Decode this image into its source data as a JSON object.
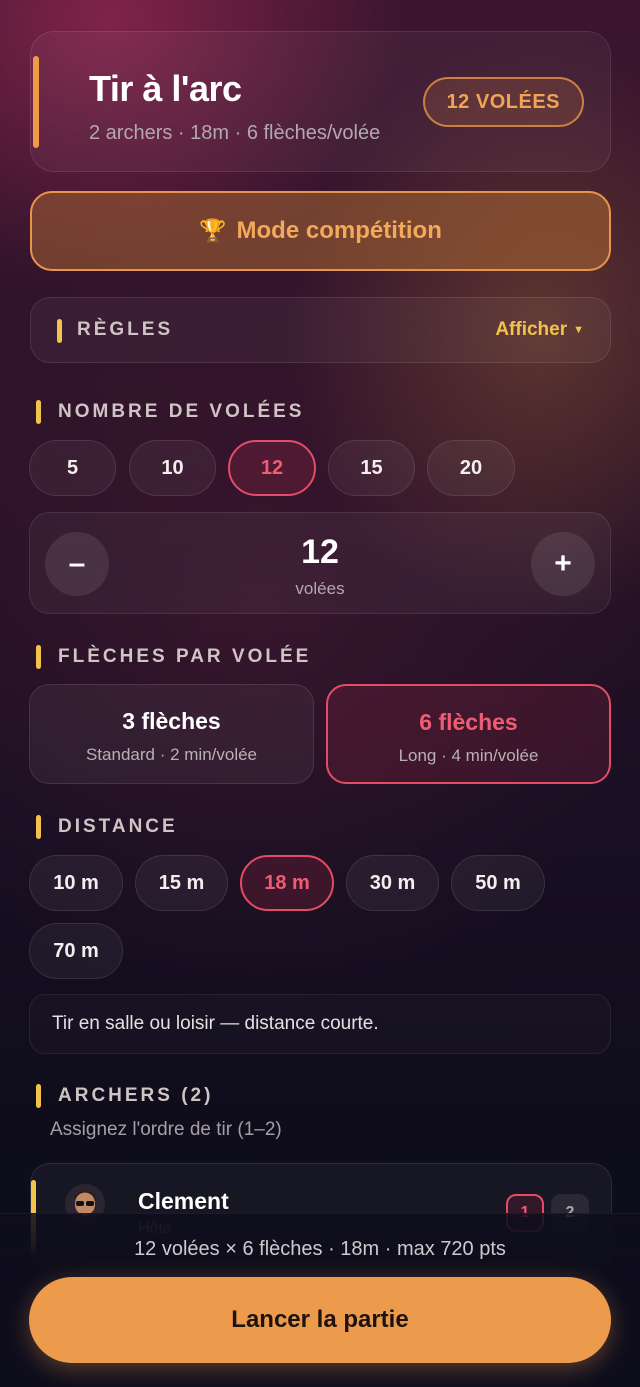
{
  "header": {
    "title": "Tir à l'arc",
    "subtitle": "2 archers · 18m · 6 flèches/volée",
    "badge": "12 VOLÉES"
  },
  "mode": {
    "icon": "trophy-icon",
    "label": "Mode compétition"
  },
  "rules": {
    "label": "RÈGLES",
    "toggle": "Afficher",
    "toggle_icon": "caret-down-icon"
  },
  "volleys": {
    "section_label": "NOMBRE DE VOLÉES",
    "options": [
      "5",
      "10",
      "12",
      "15",
      "20"
    ],
    "selected": "12",
    "stepper": {
      "value": "12",
      "unit": "volées",
      "minus": "–",
      "plus": "+"
    }
  },
  "arrows": {
    "section_label": "FLÈCHES PAR VOLÉE",
    "options": [
      {
        "title": "3 flèches",
        "subtitle": "Standard · 2 min/volée"
      },
      {
        "title": "6 flèches",
        "subtitle": "Long · 4 min/volée"
      }
    ],
    "selected": "6 flèches"
  },
  "distance": {
    "section_label": "DISTANCE",
    "options": [
      "10 m",
      "15 m",
      "18 m",
      "30 m",
      "50 m",
      "70 m"
    ],
    "selected": "18 m",
    "note": "Tir en salle ou loisir — distance courte."
  },
  "archers": {
    "section_label": "ARCHERS (2)",
    "subtitle": "Assignez l'ordre de tir (1–2)",
    "list": [
      {
        "name": "Clement",
        "role": "Hôte",
        "order_options": [
          "1",
          "2"
        ],
        "selected_order": "1"
      }
    ]
  },
  "footer": {
    "summary": "12 volées × 6 flèches · 18m · max 720 pts",
    "launch_label": "Lancer la partie"
  },
  "colors": {
    "accent_orange": "#ec9a4c",
    "accent_yellow": "#f3c24c",
    "selected_red": "#e34c66"
  }
}
